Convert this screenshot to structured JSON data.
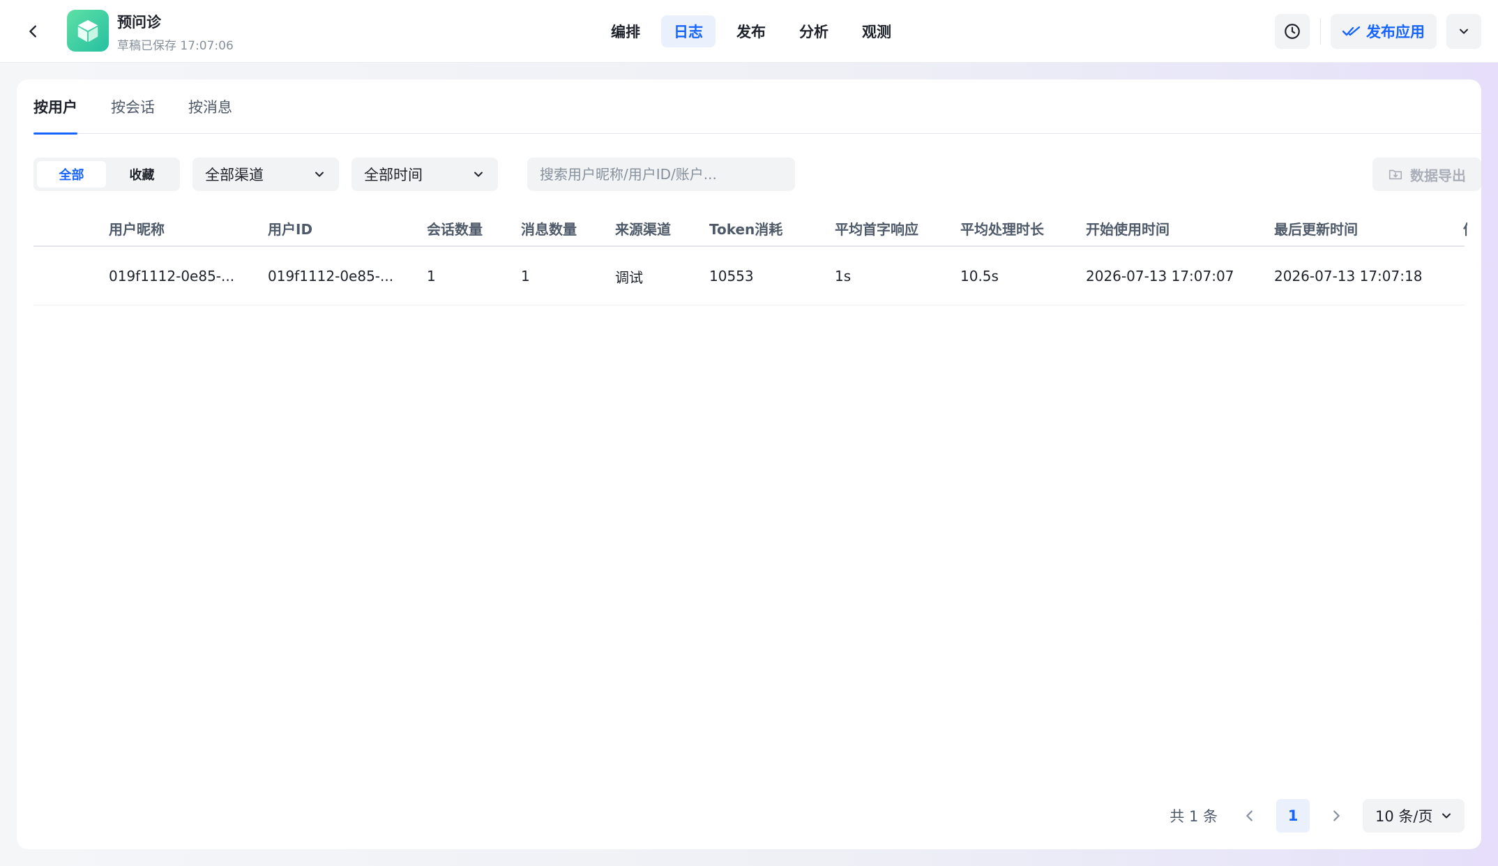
{
  "header": {
    "app_name": "预问诊",
    "save_status": "草稿已保存 17:07:06",
    "nav": [
      "编排",
      "日志",
      "发布",
      "分析",
      "观测"
    ],
    "nav_active": 1,
    "publish_label": "发布应用",
    "accent_color": "#1664ff"
  },
  "tabs": [
    "按用户",
    "按会话",
    "按消息"
  ],
  "filters": {
    "segment": [
      "全部",
      "收藏"
    ],
    "channel": "全部渠道",
    "time": "全部时间",
    "search_placeholder": "搜索用户昵称/用户ID/账户...",
    "export_label": "数据导出"
  },
  "table": {
    "columns": [
      "用户昵称",
      "用户ID",
      "会话数量",
      "消息数量",
      "来源渠道",
      "Token消耗",
      "平均首字响应",
      "平均处理时长",
      "开始使用时间",
      "最后更新时间"
    ],
    "rows": [
      [
        "019f1112-0e85-...",
        "019f1112-0e85-...",
        "1",
        "1",
        "调试",
        "10553",
        "1s",
        "10.5s",
        "2026-07-13 17:07:07",
        "2026-07-13 17:07:18"
      ]
    ]
  },
  "pagination": {
    "total": "共 1 条",
    "current_page": "1",
    "page_size": "10 条/页"
  },
  "icons": [
    "back-icon",
    "cube-icon",
    "clock-icon",
    "double-check-icon",
    "chevron-down-icon",
    "export-icon",
    "chevron-left-icon",
    "chevron-right-icon"
  ]
}
